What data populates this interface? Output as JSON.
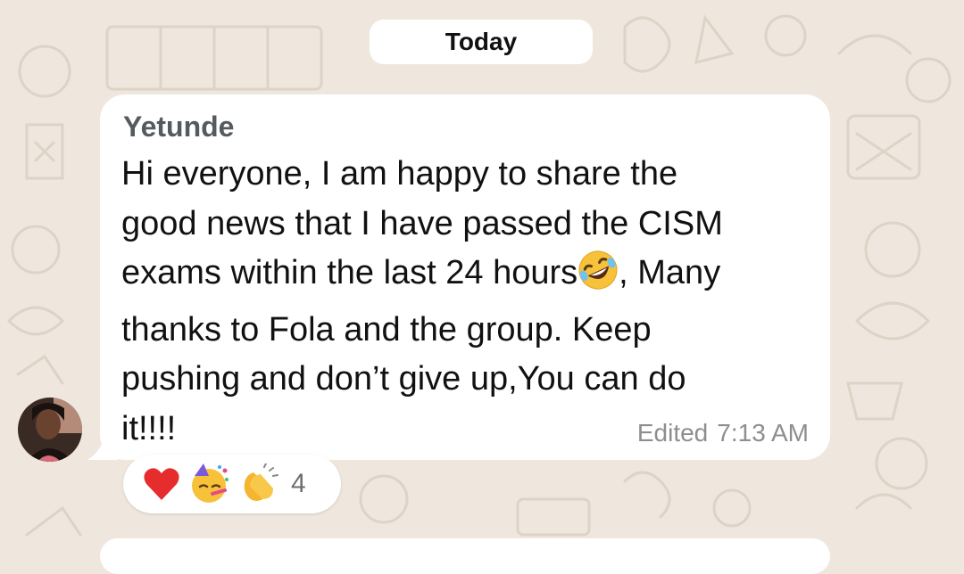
{
  "chat": {
    "date_divider": "Today",
    "message": {
      "sender": "Yetunde",
      "lines": [
        "Hi everyone, I am happy to share the",
        "good news that I have passed the CISM",
        "exams within the last 24 hours",
        ", Many",
        "thanks to Fola and the group. Keep",
        "pushing and don’t give up,You can do",
        "it!!!!"
      ],
      "inline_emoji": "rolling-on-floor-laughing-emoji",
      "edited_label": "Edited",
      "time": "7:13 AM",
      "avatar_icon": "user-avatar-photo"
    },
    "reactions": {
      "items": [
        "heart-emoji",
        "partying-face-emoji",
        "clapping-hands-emoji"
      ],
      "count": "4"
    }
  },
  "colors": {
    "wallpaper": "#efe7dd",
    "bubble": "#ffffff",
    "meta_text": "#8c8e90",
    "sender_text": "#555a5e"
  }
}
